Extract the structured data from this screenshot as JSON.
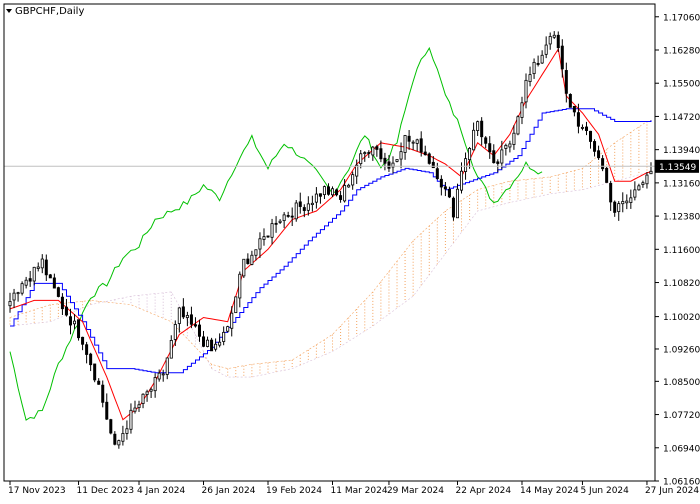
{
  "chart_data": {
    "type": "candlestick",
    "title": "GBPCHF,Daily",
    "symbol": "GBPCHF",
    "timeframe": "Daily",
    "current_price": 1.13549,
    "current_price_label": "1.13549",
    "ylim": [
      1.0616,
      1.1736
    ],
    "y_ticks": [
      1.1706,
      1.1628,
      1.155,
      1.1472,
      1.1394,
      1.1316,
      1.1238,
      1.116,
      1.1082,
      1.1002,
      1.0926,
      1.085,
      1.0772,
      1.0694,
      1.0616
    ],
    "y_tick_labels": [
      "1.17060",
      "1.16280",
      "1.15500",
      "1.14720",
      "1.13940",
      "1.13160",
      "1.12380",
      "1.11600",
      "1.10820",
      "1.10020",
      "1.09260",
      "1.08500",
      "1.07720",
      "1.06940",
      "1.06160"
    ],
    "x_tick_labels": [
      {
        "index": 0,
        "label": "17 Nov 2023"
      },
      {
        "index": 17,
        "label": "11 Dec 2023"
      },
      {
        "index": 32,
        "label": "4 Jan 2024"
      },
      {
        "index": 48,
        "label": "26 Jan 2024"
      },
      {
        "index": 64,
        "label": "19 Feb 2024"
      },
      {
        "index": 80,
        "label": "11 Mar 2024"
      },
      {
        "index": 94,
        "label": "29 Mar 2024"
      },
      {
        "index": 111,
        "label": "22 Apr 2024"
      },
      {
        "index": 127,
        "label": "14 May 2024"
      },
      {
        "index": 142,
        "label": "5 Jun 2024"
      },
      {
        "index": 158,
        "label": "27 Jun 2024"
      }
    ],
    "colors": {
      "candle": "#000000",
      "tenkan": "#ff0000",
      "kijun": "#0000ff",
      "chikou": "#00c000",
      "cloud_up": "#f4a460",
      "cloud_down": "#d8bfd8",
      "price_line": "#c0c0c0",
      "price_label_bg": "#000000"
    },
    "anchors": [
      [
        0,
        1.105
      ],
      [
        4,
        1.109
      ],
      [
        8,
        1.113
      ],
      [
        10,
        1.108
      ],
      [
        14,
        1.101
      ],
      [
        18,
        1.095
      ],
      [
        22,
        1.084
      ],
      [
        26,
        1.069
      ],
      [
        30,
        1.077
      ],
      [
        34,
        1.082
      ],
      [
        38,
        1.087
      ],
      [
        42,
        1.101
      ],
      [
        46,
        1.097
      ],
      [
        50,
        1.092
      ],
      [
        54,
        1.097
      ],
      [
        58,
        1.113
      ],
      [
        62,
        1.117
      ],
      [
        66,
        1.123
      ],
      [
        70,
        1.125
      ],
      [
        74,
        1.127
      ],
      [
        78,
        1.13
      ],
      [
        82,
        1.128
      ],
      [
        86,
        1.136
      ],
      [
        90,
        1.141
      ],
      [
        94,
        1.135
      ],
      [
        98,
        1.142
      ],
      [
        102,
        1.14
      ],
      [
        106,
        1.134
      ],
      [
        110,
        1.125
      ],
      [
        112,
        1.135
      ],
      [
        116,
        1.146
      ],
      [
        120,
        1.135
      ],
      [
        124,
        1.141
      ],
      [
        128,
        1.155
      ],
      [
        132,
        1.162
      ],
      [
        134,
        1.167
      ],
      [
        136,
        1.163
      ],
      [
        138,
        1.152
      ],
      [
        142,
        1.144
      ],
      [
        146,
        1.138
      ],
      [
        150,
        1.125
      ],
      [
        154,
        1.128
      ],
      [
        158,
        1.1345
      ]
    ],
    "tenkan_anchors": [
      [
        0,
        1.102
      ],
      [
        6,
        1.104
      ],
      [
        12,
        1.104
      ],
      [
        18,
        1.099
      ],
      [
        24,
        1.086
      ],
      [
        28,
        1.076
      ],
      [
        32,
        1.079
      ],
      [
        36,
        1.085
      ],
      [
        42,
        1.096
      ],
      [
        48,
        1.1
      ],
      [
        54,
        1.099
      ],
      [
        58,
        1.111
      ],
      [
        64,
        1.116
      ],
      [
        70,
        1.123
      ],
      [
        76,
        1.125
      ],
      [
        82,
        1.13
      ],
      [
        86,
        1.136
      ],
      [
        92,
        1.141
      ],
      [
        98,
        1.14
      ],
      [
        104,
        1.138
      ],
      [
        108,
        1.136
      ],
      [
        112,
        1.133
      ],
      [
        116,
        1.141
      ],
      [
        120,
        1.138
      ],
      [
        124,
        1.143
      ],
      [
        128,
        1.151
      ],
      [
        132,
        1.157
      ],
      [
        136,
        1.163
      ],
      [
        138,
        1.152
      ],
      [
        142,
        1.148
      ],
      [
        146,
        1.143
      ],
      [
        150,
        1.132
      ],
      [
        154,
        1.132
      ],
      [
        158,
        1.134
      ]
    ],
    "kijun_anchors": [
      [
        0,
        1.098
      ],
      [
        6,
        1.108
      ],
      [
        12,
        1.108
      ],
      [
        18,
        1.099
      ],
      [
        24,
        1.088
      ],
      [
        30,
        1.088
      ],
      [
        36,
        1.087
      ],
      [
        42,
        1.087
      ],
      [
        50,
        1.093
      ],
      [
        56,
        1.1
      ],
      [
        62,
        1.107
      ],
      [
        68,
        1.112
      ],
      [
        74,
        1.118
      ],
      [
        82,
        1.125
      ],
      [
        86,
        1.13
      ],
      [
        92,
        1.133
      ],
      [
        98,
        1.135
      ],
      [
        104,
        1.134
      ],
      [
        108,
        1.13
      ],
      [
        114,
        1.132
      ],
      [
        120,
        1.134
      ],
      [
        126,
        1.138
      ],
      [
        132,
        1.148
      ],
      [
        138,
        1.149
      ],
      [
        144,
        1.149
      ],
      [
        150,
        1.146
      ],
      [
        158,
        1.146
      ]
    ],
    "chikou_anchors": [
      [
        0,
        1.092
      ],
      [
        4,
        1.076
      ],
      [
        8,
        1.078
      ],
      [
        12,
        1.089
      ],
      [
        16,
        1.097
      ],
      [
        20,
        1.105
      ],
      [
        24,
        1.108
      ],
      [
        28,
        1.114
      ],
      [
        32,
        1.117
      ],
      [
        36,
        1.123
      ],
      [
        40,
        1.125
      ],
      [
        44,
        1.127
      ],
      [
        48,
        1.131
      ],
      [
        52,
        1.128
      ],
      [
        56,
        1.136
      ],
      [
        60,
        1.142
      ],
      [
        64,
        1.135
      ],
      [
        68,
        1.141
      ],
      [
        72,
        1.138
      ],
      [
        76,
        1.134
      ],
      [
        80,
        1.129
      ],
      [
        84,
        1.135
      ],
      [
        88,
        1.143
      ],
      [
        92,
        1.135
      ],
      [
        96,
        1.141
      ],
      [
        100,
        1.156
      ],
      [
        104,
        1.164
      ],
      [
        108,
        1.152
      ],
      [
        112,
        1.144
      ],
      [
        116,
        1.133
      ],
      [
        120,
        1.127
      ],
      [
        124,
        1.131
      ],
      [
        128,
        1.136
      ],
      [
        132,
        1.134
      ]
    ],
    "spanA_anchors": [
      [
        0,
        1.1
      ],
      [
        10,
        1.103
      ],
      [
        20,
        1.104
      ],
      [
        30,
        1.103
      ],
      [
        40,
        1.099
      ],
      [
        46,
        1.093
      ],
      [
        50,
        1.089
      ],
      [
        54,
        1.088
      ],
      [
        60,
        1.089
      ],
      [
        70,
        1.09
      ],
      [
        80,
        1.096
      ],
      [
        90,
        1.106
      ],
      [
        100,
        1.118
      ],
      [
        108,
        1.125
      ],
      [
        116,
        1.13
      ],
      [
        124,
        1.132
      ],
      [
        134,
        1.133
      ],
      [
        142,
        1.135
      ],
      [
        150,
        1.141
      ],
      [
        158,
        1.146
      ]
    ],
    "spanB_anchors": [
      [
        0,
        1.098
      ],
      [
        10,
        1.099
      ],
      [
        20,
        1.103
      ],
      [
        30,
        1.105
      ],
      [
        40,
        1.106
      ],
      [
        46,
        1.096
      ],
      [
        50,
        1.088
      ],
      [
        54,
        1.086
      ],
      [
        60,
        1.086
      ],
      [
        70,
        1.088
      ],
      [
        80,
        1.092
      ],
      [
        90,
        1.098
      ],
      [
        100,
        1.105
      ],
      [
        108,
        1.115
      ],
      [
        116,
        1.125
      ],
      [
        124,
        1.127
      ],
      [
        134,
        1.129
      ],
      [
        142,
        1.13
      ],
      [
        150,
        1.132
      ],
      [
        158,
        1.134
      ]
    ],
    "candle_count": 160,
    "grid": false,
    "legend": "none"
  }
}
